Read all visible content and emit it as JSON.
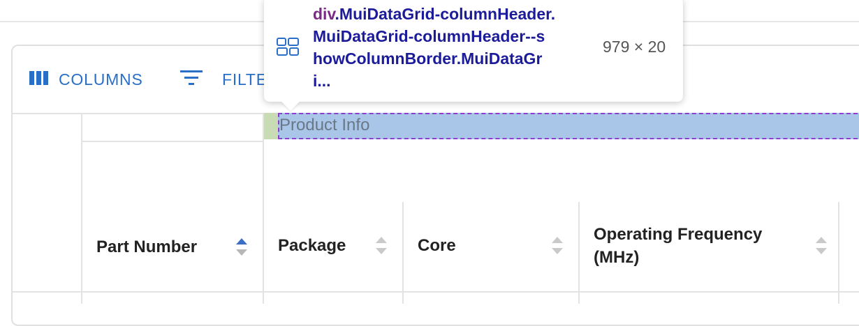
{
  "toolbar": {
    "columns_label": "COLUMNS",
    "filters_label": "FILTE"
  },
  "column_group": {
    "label": "Product Info"
  },
  "columns": [
    {
      "title": "Part Number",
      "sort": "asc"
    },
    {
      "title": "Package",
      "sort": "none"
    },
    {
      "title": "Core",
      "sort": "none"
    },
    {
      "title_line1": "Operating Frequency",
      "title_line2": "(MHz)",
      "sort": "none"
    }
  ],
  "inspector_tooltip": {
    "tag": "div",
    "selector_line1": ".MuiDataGrid-columnHeader.",
    "selector_line2": "MuiDataGrid-columnHeader--s",
    "selector_line3": "howColumnBorder.MuiDataGr",
    "selector_line4": "i...",
    "dimensions": "979 × 20"
  },
  "colors": {
    "accent": "#2a6fc7",
    "highlight_fill": "#a9c6e8",
    "highlight_border": "#8a3fcf",
    "tag_color": "#7b2a86",
    "selector_color": "#1c1c9a"
  }
}
